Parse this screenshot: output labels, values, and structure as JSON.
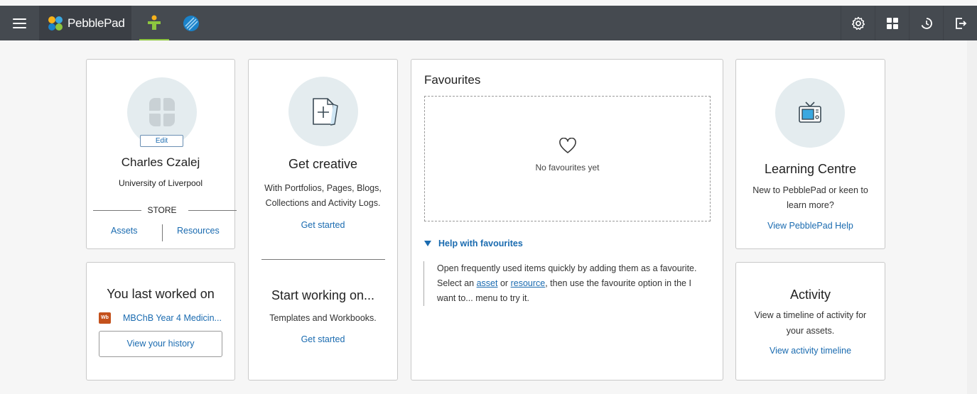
{
  "app": {
    "brand": "PebblePad"
  },
  "topbar": {
    "menu_icon": "hamburger-icon",
    "tabs": [
      {
        "icon": "person-icon",
        "active": true
      },
      {
        "icon": "atlas-icon",
        "active": false
      }
    ],
    "right_icons": [
      "gear-icon",
      "dashboard-icon",
      "history-icon",
      "logout-icon"
    ],
    "colors": {
      "bar": "#454a50",
      "accent": "#8dc63f",
      "link": "#1a6bb0"
    }
  },
  "profile": {
    "edit_label": "Edit",
    "name": "Charles Czalej",
    "institution": "University of Liverpool",
    "store_label": "STORE",
    "assets_link": "Assets",
    "resources_link": "Resources"
  },
  "last_worked": {
    "title": "You last worked on",
    "item_badge": "Wb",
    "item_label": "MBChB Year 4 Medicin...",
    "history_button": "View your history"
  },
  "create": {
    "title": "Get creative",
    "line1": "With Portfolios, Pages, Blogs,",
    "line2": "Collections and Activity Logs.",
    "link": "Get started",
    "start_title": "Start working on...",
    "start_desc": "Templates and Workbooks.",
    "start_link": "Get started"
  },
  "favourites": {
    "title": "Favourites",
    "empty_text": "No favourites yet",
    "help_toggle": "Help with favourites",
    "help_part1": "Open frequently used items quickly by adding them as a favourite. Select an",
    "help_link_asset": "asset",
    "help_or": "or",
    "help_link_resource": "resource",
    "help_part2": ", then use the favourite option in the I want to... menu to try it."
  },
  "learning": {
    "title": "Learning Centre",
    "line1": "New to PebblePad or keen to",
    "line2": "learn more?",
    "link": "View PebblePad Help"
  },
  "activity": {
    "title": "Activity",
    "line1": "View a timeline of activity for",
    "line2": "your assets.",
    "link": "View activity timeline"
  }
}
